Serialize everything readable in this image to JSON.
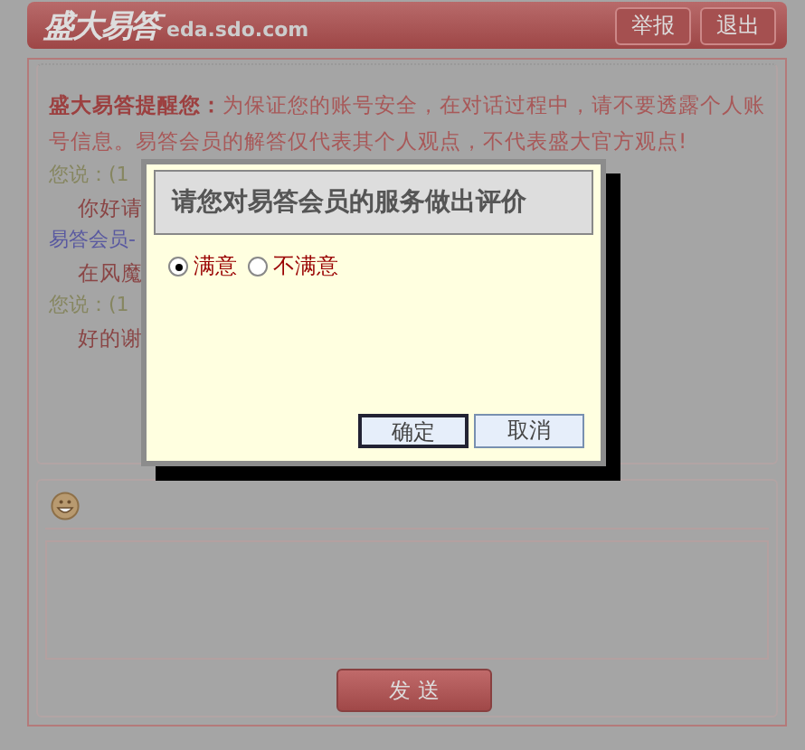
{
  "header": {
    "logo": "盛大易答",
    "domain": "eda.sdo.com",
    "buttons": [
      "举报",
      "退出"
    ]
  },
  "notice": {
    "label": "盛大易答提醒您：",
    "text": "为保证您的账号安全，在对话过程中，请不要透露个人账号信息。易答会员的解答仅代表其个人观点，不代表盛大官方观点!"
  },
  "messages": [
    {
      "kind": "user",
      "speaker": "您说：(1",
      "text": "你好请"
    },
    {
      "kind": "member",
      "speaker": "易答会员-",
      "text": "在风魔"
    },
    {
      "kind": "user",
      "speaker": "您说：(1",
      "text": "好的谢"
    }
  ],
  "composer": {
    "send_button": "发 送"
  },
  "dialog": {
    "title": "请您对易答会员的服务做出评价",
    "options": [
      {
        "label": "满意",
        "selected": true
      },
      {
        "label": "不满意",
        "selected": false
      }
    ],
    "buttons": [
      {
        "label": "确定",
        "selected": true
      },
      {
        "label": "取消",
        "selected": false
      }
    ]
  }
}
